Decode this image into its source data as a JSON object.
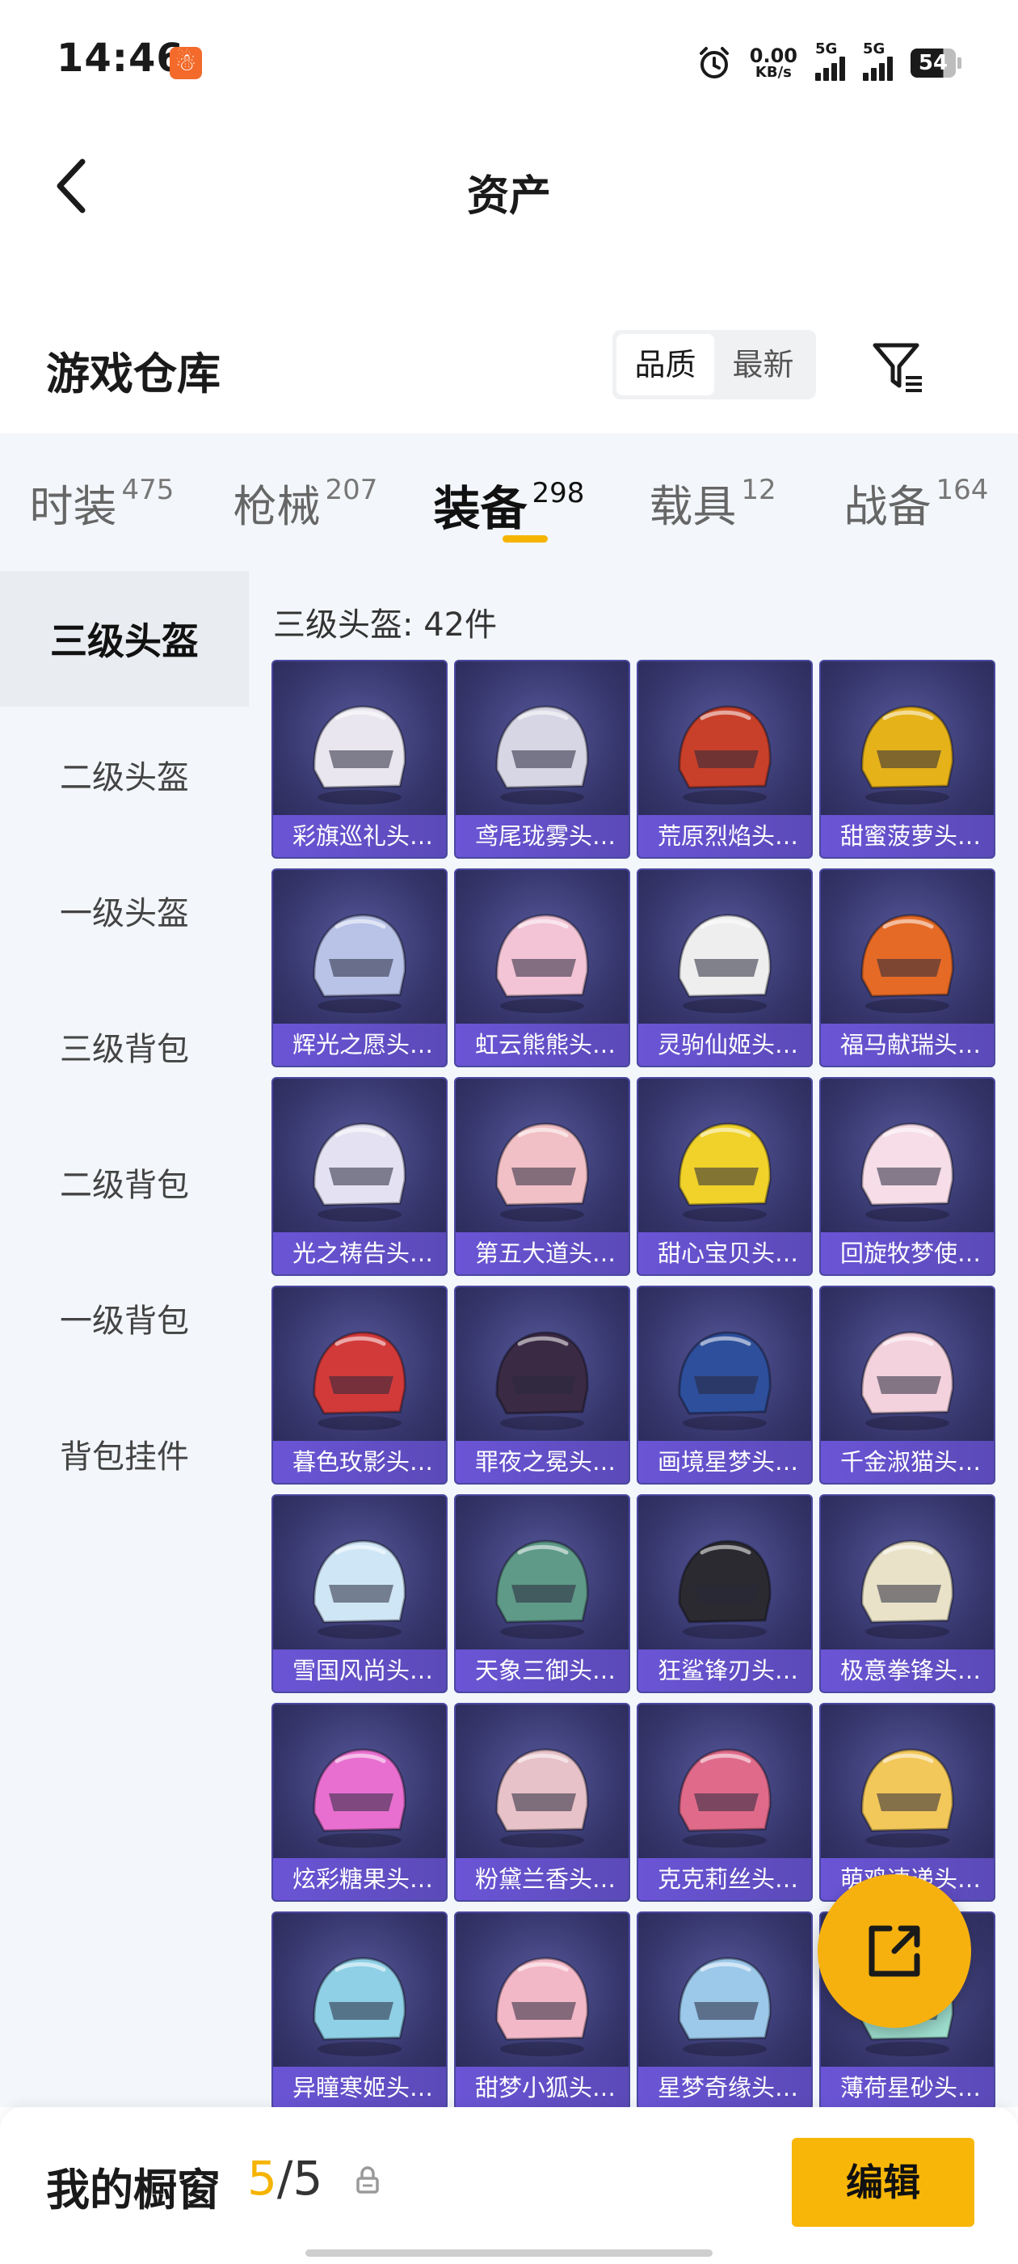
{
  "status_bar": {
    "time": "14:46",
    "net_speed_value": "0.00",
    "net_speed_unit": "KB/s",
    "signal_1_label": "5G",
    "signal_2_label": "5G",
    "battery_level": "54"
  },
  "nav": {
    "title": "资产",
    "back_icon": "chevron-left-icon"
  },
  "header": {
    "title": "游戏仓库",
    "sort_options": [
      "品质",
      "最新"
    ],
    "sort_selected": "品质",
    "filter_icon": "filter-icon"
  },
  "category_tabs": [
    {
      "label": "时装",
      "count": "475",
      "active": false
    },
    {
      "label": "枪械",
      "count": "207",
      "active": false
    },
    {
      "label": "装备",
      "count": "298",
      "active": true
    },
    {
      "label": "载具",
      "count": "12",
      "active": false
    },
    {
      "label": "战备",
      "count": "164",
      "active": false
    }
  ],
  "sidebar": {
    "items": [
      "三级头盔",
      "二级头盔",
      "一级头盔",
      "三级背包",
      "二级背包",
      "一级背包",
      "背包挂件"
    ],
    "active_index": 0
  },
  "main": {
    "subcategory_count_text": "三级头盔: 42件",
    "items": [
      {
        "name": "彩旗巡礼头…",
        "color": "#e9e6f0"
      },
      {
        "name": "鸢尾珑雾头…",
        "color": "#d7d6e4"
      },
      {
        "name": "荒原烈焰头…",
        "color": "#c8402a"
      },
      {
        "name": "甜蜜菠萝头…",
        "color": "#e6b21a"
      },
      {
        "name": "辉光之愿头…",
        "color": "#b9c3e8"
      },
      {
        "name": "虹云熊熊头…",
        "color": "#f2c4d6"
      },
      {
        "name": "灵驹仙姬头…",
        "color": "#eeeeee"
      },
      {
        "name": "福马献瑞头…",
        "color": "#e56a26"
      },
      {
        "name": "光之祷告头…",
        "color": "#e4e2f2"
      },
      {
        "name": "第五大道头…",
        "color": "#f1c0c6"
      },
      {
        "name": "甜心宝贝头…",
        "color": "#f0d22a"
      },
      {
        "name": "回旋牧梦使…",
        "color": "#f6dde8"
      },
      {
        "name": "暮色玫影头…",
        "color": "#d23a3a"
      },
      {
        "name": "罪夜之冕头…",
        "color": "#3a2a44"
      },
      {
        "name": "画境星梦头…",
        "color": "#2e4f9c"
      },
      {
        "name": "千金淑猫头…",
        "color": "#f4d2dd"
      },
      {
        "name": "雪国风尚头…",
        "color": "#cfe6f6"
      },
      {
        "name": "天象三御头…",
        "color": "#5f9a88"
      },
      {
        "name": "狂鲨锋刃头…",
        "color": "#2a2a30"
      },
      {
        "name": "极意拳锋头…",
        "color": "#e9e2c8"
      },
      {
        "name": "炫彩糖果头…",
        "color": "#e86fd0"
      },
      {
        "name": "粉黛兰香头…",
        "color": "#e7c2c8"
      },
      {
        "name": "克克莉丝头…",
        "color": "#e06a8a"
      },
      {
        "name": "萌鸡速递头…",
        "color": "#f3c85a"
      },
      {
        "name": "异瞳寒姬头…",
        "color": "#8fd0e6"
      },
      {
        "name": "甜梦小狐头…",
        "color": "#f3b8c8"
      },
      {
        "name": "星梦奇缘头…",
        "color": "#9cc8ea"
      },
      {
        "name": "薄荷星砂头…",
        "color": "#9fe0d0"
      }
    ]
  },
  "fab": {
    "icon": "share-icon"
  },
  "bottom_bar": {
    "label": "我的橱窗",
    "current": "5",
    "separator": "/",
    "total": "5",
    "lock_icon": "lock-icon",
    "edit_label": "编辑"
  },
  "colors": {
    "accent": "#f5b400",
    "card_bg": "#35356b",
    "card_label_bg": "#6b55d6",
    "panel_bg": "#f3f6fa"
  }
}
